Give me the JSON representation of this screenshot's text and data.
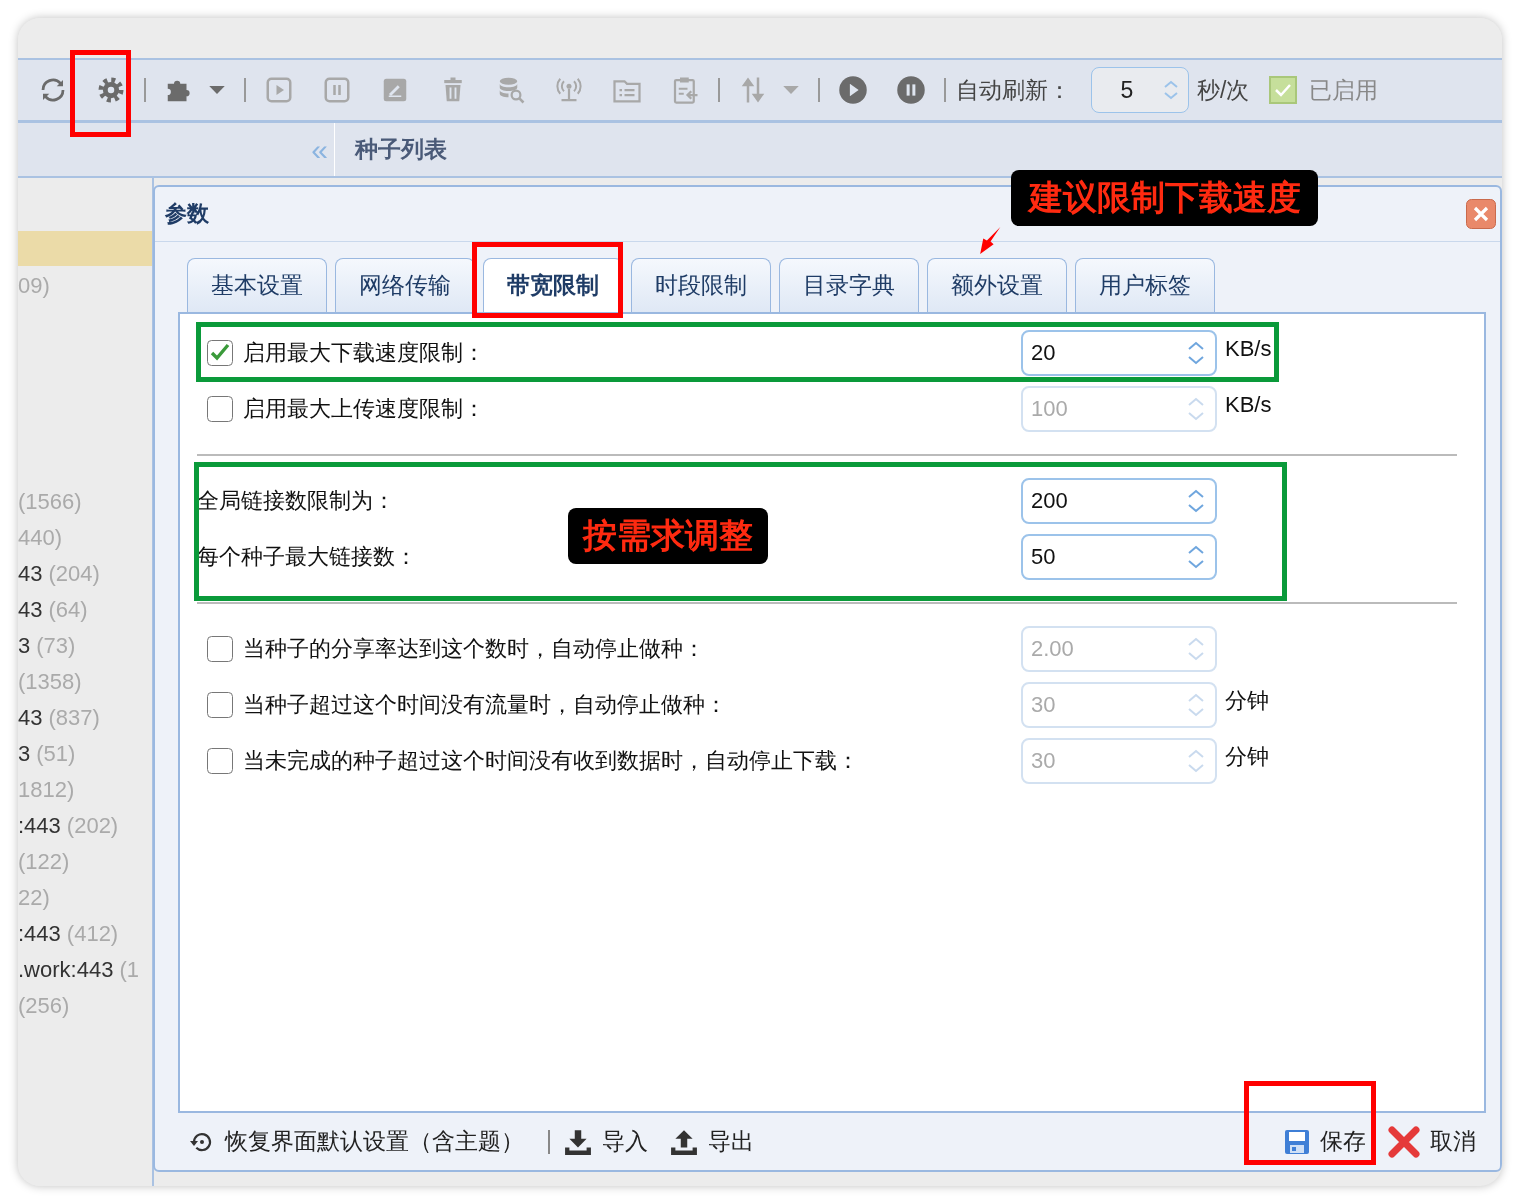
{
  "toolbar": {
    "buttons": [
      {
        "kind": "button",
        "disabled": false
      },
      {
        "kind": "button",
        "disabled": false
      },
      {
        "kind": "separator"
      },
      {
        "kind": "menu",
        "disabled": false
      },
      {
        "kind": "separator"
      },
      {
        "kind": "button",
        "disabled": true
      },
      {
        "kind": "button",
        "disabled": true
      },
      {
        "kind": "button",
        "disabled": true
      },
      {
        "kind": "button",
        "disabled": true
      },
      {
        "kind": "button",
        "disabled": true
      },
      {
        "kind": "button",
        "disabled": true
      },
      {
        "kind": "button",
        "disabled": true
      },
      {
        "kind": "button",
        "disabled": true
      },
      {
        "kind": "separator"
      },
      {
        "kind": "menu",
        "disabled": true
      },
      {
        "kind": "separator"
      },
      {
        "kind": "button",
        "disabled": false
      },
      {
        "kind": "button",
        "disabled": false
      },
      {
        "kind": "separator"
      }
    ],
    "refresh_label": "自动刷新：",
    "refresh_value": "5",
    "refresh_unit": "秒/次",
    "enabled_label": "已启用",
    "enabled_checked": true
  },
  "sidebar": {
    "collapse": "«",
    "items": [
      {
        "selected": true
      },
      {
        "count": "09)",
        "selected": false
      },
      {
        "count": "(1566)",
        "selected": false
      },
      {
        "count": "440)",
        "selected": false
      },
      {
        "label": "43",
        "count": "(204)",
        "selected": false
      },
      {
        "label": "43",
        "count": "(64)",
        "selected": false
      },
      {
        "label": "3",
        "count": "(73)",
        "selected": false
      },
      {
        "count": "(1358)",
        "selected": false
      },
      {
        "label": "43",
        "count": "(837)",
        "selected": false
      },
      {
        "label": "3",
        "count": "(51)",
        "selected": false
      },
      {
        "count": "1812)",
        "selected": false
      },
      {
        "label": ":443",
        "count": "(202)",
        "selected": false
      },
      {
        "count": "(122)",
        "selected": false
      },
      {
        "count": "22)",
        "selected": false
      },
      {
        "label": ":443",
        "count": "(412)",
        "selected": false
      },
      {
        "label": ".work:443",
        "count": "(1",
        "selected": false
      },
      {
        "count": "(256)",
        "selected": false
      }
    ]
  },
  "main_title": "种子列表",
  "dialog": {
    "title": "参数",
    "tabs": [
      {
        "label": "基本设置",
        "selected": false
      },
      {
        "label": "网络传输",
        "selected": false
      },
      {
        "label": "带宽限制",
        "selected": true
      },
      {
        "label": "时段限制",
        "selected": false
      },
      {
        "label": "目录字典",
        "selected": false
      },
      {
        "label": "额外设置",
        "selected": false
      },
      {
        "label": "用户标签",
        "selected": false
      }
    ],
    "sections": [
      {
        "rows": [
          {
            "kind": "checkbox",
            "checked": true,
            "label": "启用最大下载速度限制：",
            "value": "20",
            "unit": "KB/s"
          },
          {
            "kind": "checkbox",
            "checked": false,
            "label": "启用最大上传速度限制：",
            "value": "100",
            "unit": "KB/s"
          }
        ]
      },
      {
        "rows": [
          {
            "kind": "plain",
            "label": "全局链接数限制为：",
            "value": "200"
          },
          {
            "kind": "plain",
            "label": "每个种子最大链接数：",
            "value": "50"
          }
        ]
      },
      {
        "rows": [
          {
            "kind": "checkbox",
            "checked": false,
            "label": "当种子的分享率达到这个数时，自动停止做种：",
            "value": "2.00"
          },
          {
            "kind": "checkbox",
            "checked": false,
            "label": "当种子超过这个时间没有流量时，自动停止做种：",
            "value": "30",
            "unit": "分钟"
          },
          {
            "kind": "checkbox",
            "checked": false,
            "label": "当未完成的种子超过这个时间没有收到数据时，自动停止下载：",
            "value": "30",
            "unit": "分钟"
          }
        ]
      }
    ],
    "footer": {
      "reset": "恢复界面默认设置（含主题）",
      "import": "导入",
      "export": "导出",
      "save": "保存",
      "cancel": "取消"
    }
  },
  "annotations": [
    {
      "kind": "box",
      "color": "#ff0000"
    },
    {
      "kind": "box",
      "color": "#ff0000"
    },
    {
      "kind": "box",
      "color": "#ff0000"
    },
    {
      "kind": "box",
      "color": "#0a9a3a"
    },
    {
      "kind": "box",
      "color": "#0a9a3a"
    },
    {
      "kind": "callout",
      "text": "建议限制下载速度"
    },
    {
      "kind": "callout",
      "text": "按需求调整"
    },
    {
      "kind": "arrow",
      "color": "#ff0000"
    }
  ]
}
